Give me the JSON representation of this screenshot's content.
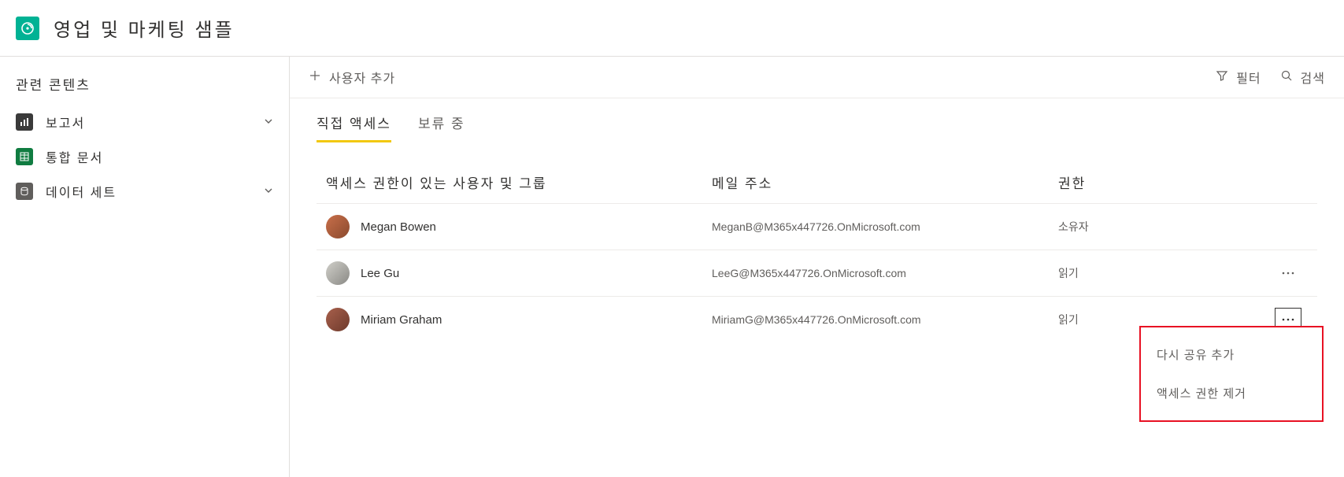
{
  "header": {
    "title": "영업 및 마케팅 샘플"
  },
  "sidebar": {
    "heading": "관련 콘텐츠",
    "items": [
      {
        "label": "보고서",
        "expandable": true
      },
      {
        "label": "통합 문서",
        "expandable": false
      },
      {
        "label": "데이터 세트",
        "expandable": true
      }
    ]
  },
  "toolbar": {
    "add_user": "사용자 추가",
    "filter": "필터",
    "search": "검색"
  },
  "tabs": {
    "direct_access": "직접 액세스",
    "pending": "보류 중"
  },
  "table": {
    "columns": {
      "user": "액세스 권한이 있는 사용자 및 그룹",
      "email": "메일 주소",
      "permission": "권한"
    },
    "rows": [
      {
        "name": "Megan Bowen",
        "email": "MeganB@M365x447726.OnMicrosoft.com",
        "permission": "소유자",
        "has_more": false
      },
      {
        "name": "Lee Gu",
        "email": "LeeG@M365x447726.OnMicrosoft.com",
        "permission": "읽기",
        "has_more": true
      },
      {
        "name": "Miriam Graham",
        "email": "MiriamG@M365x447726.OnMicrosoft.com",
        "permission": "읽기",
        "has_more": true
      }
    ]
  },
  "context_menu": {
    "reshare": "다시 공유 추가",
    "remove": "액세스 권한 제거"
  }
}
